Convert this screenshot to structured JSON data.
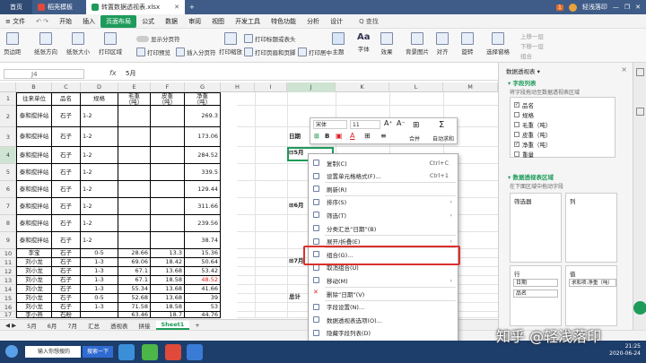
{
  "tabs": {
    "home": "首页",
    "t1": "稻壳模板",
    "t2": "转置数据透视表.xlsx",
    "badge": "1",
    "user": "轻浅落印"
  },
  "menu": {
    "file": "≡ 文件",
    "items": [
      "开始",
      "插入",
      "页面布局",
      "公式",
      "数据",
      "审阅",
      "视图",
      "开发工具",
      "特色功能",
      "分析",
      "设计"
    ],
    "active": "页面布局",
    "search": "Q 查找"
  },
  "toolbar": {
    "page_margin": "页边距",
    "orientation": "纸张方向",
    "size": "纸张大小",
    "print_area": "打印区域",
    "show_break": "显示分页符",
    "print_preview": "打印预览",
    "insert_break": "插入分页符",
    "print_scale": "打印缩放",
    "print_titles": "打印标题或表头",
    "print_header": "打印页眉和页脚",
    "print_center": "打印居中",
    "theme": "主题",
    "font": "字体",
    "effect": "效果",
    "bg": "背景图片",
    "align": "对齐",
    "rotate": "旋转",
    "select_pane": "选择窗格",
    "up": "上移一层",
    "down": "下移一层",
    "group": "组合"
  },
  "formula": {
    "namebox": "J4",
    "fx": "fx",
    "value": "5月"
  },
  "columns": [
    "B",
    "C",
    "D",
    "E",
    "F",
    "G",
    "H",
    "I",
    "J",
    "K",
    "L",
    "M"
  ],
  "rows": [
    "1",
    "2",
    "3",
    "4",
    "5",
    "6",
    "7",
    "8",
    "9",
    "10",
    "11",
    "12",
    "13",
    "14",
    "15",
    "16",
    "17"
  ],
  "table": {
    "h1": "往来单位",
    "h2": "品名",
    "h3": "规格",
    "h4": "毛重\n（吨）",
    "h5": "皮重\n（吨）",
    "h6": "净重\n（吨）",
    "top": [
      {
        "u": "泰和搅拌站",
        "p": "石子",
        "s": "1-2",
        "g": "",
        "t": "",
        "n": "269.3"
      },
      {
        "u": "泰和搅拌站",
        "p": "石子",
        "s": "1-2",
        "g": "",
        "t": "",
        "n": "173.06"
      },
      {
        "u": "泰和搅拌站",
        "p": "石子",
        "s": "1-2",
        "g": "",
        "t": "",
        "n": "284.52"
      },
      {
        "u": "泰和搅拌站",
        "p": "石子",
        "s": "1-2",
        "g": "",
        "t": "",
        "n": "339.5"
      },
      {
        "u": "泰和搅拌站",
        "p": "石子",
        "s": "1-2",
        "g": "",
        "t": "",
        "n": "129.44"
      },
      {
        "u": "泰和搅拌站",
        "p": "石子",
        "s": "1-2",
        "g": "",
        "t": "",
        "n": "311.66"
      },
      {
        "u": "泰和搅拌站",
        "p": "石子",
        "s": "1-2",
        "g": "",
        "t": "",
        "n": "239.56"
      },
      {
        "u": "泰和搅拌站",
        "p": "石子",
        "s": "1-2",
        "g": "",
        "t": "",
        "n": "38.74"
      }
    ],
    "bottom": [
      {
        "u": "李宝",
        "p": "石子",
        "s": "0-5",
        "g": "28.66",
        "t": "13.3",
        "n": "15.36"
      },
      {
        "u": "刘小龙",
        "p": "石子",
        "s": "1-3",
        "g": "69.06",
        "t": "18.42",
        "n": "50.64"
      },
      {
        "u": "刘小龙",
        "p": "石子",
        "s": "1-3",
        "g": "67.1",
        "t": "13.68",
        "n": "53.42"
      },
      {
        "u": "刘小龙",
        "p": "石子",
        "s": "1-3",
        "g": "67.1",
        "t": "18.58",
        "n": "48.52"
      },
      {
        "u": "刘小龙",
        "p": "石子",
        "s": "1-3",
        "g": "55.34",
        "t": "13.68",
        "n": "41.66"
      },
      {
        "u": "刘小龙",
        "p": "石子",
        "s": "0-5",
        "g": "52.68",
        "t": "13.68",
        "n": "39"
      },
      {
        "u": "刘小龙",
        "p": "石子",
        "s": "1-3",
        "g": "71.58",
        "t": "18.58",
        "n": "53"
      },
      {
        "u": "李小燕",
        "p": "石粉",
        "s": "",
        "g": "63.46",
        "t": "18.7",
        "n": "44.76"
      }
    ],
    "pivot_date": "日期",
    "pivot_may": "⊟5月",
    "pivot_jun": "⊞6月",
    "pivot_jul": "⊞7月",
    "pivot_total": "总计"
  },
  "minitb": {
    "font": "宋体",
    "size": "11",
    "merge": "合并",
    "autosum": "自动求和"
  },
  "context_menu": [
    {
      "label": "复制(C)",
      "shortcut": "Ctrl+C"
    },
    {
      "label": "设置单元格格式(F)...",
      "shortcut": "Ctrl+1"
    },
    {
      "label": "刷新(R)",
      "shortcut": ""
    },
    {
      "label": "排序(S)",
      "shortcut": "",
      "sub": true
    },
    {
      "label": "筛选(T)",
      "shortcut": "",
      "sub": true
    },
    {
      "label": "分类汇总“日期”(B)",
      "shortcut": ""
    },
    {
      "label": "展开/折叠(E)",
      "shortcut": "",
      "sub": true
    },
    {
      "label": "组合(G)...",
      "shortcut": ""
    },
    {
      "label": "取消组合(U)",
      "shortcut": ""
    },
    {
      "label": "移动(M)",
      "shortcut": "",
      "sub": true
    },
    {
      "label": "删除“日期”(V)",
      "shortcut": ""
    },
    {
      "label": "字段设置(N)...",
      "shortcut": ""
    },
    {
      "label": "数据透视表选项(O)...",
      "shortcut": ""
    },
    {
      "label": "隐藏字段列表(D)",
      "shortcut": ""
    }
  ],
  "panel": {
    "title": "数据透视表 ▾",
    "field_list": "▾ 字段列表",
    "hint": "将字段拖动至数据透视表区域",
    "fields": [
      {
        "name": "品名",
        "checked": true
      },
      {
        "name": "规格",
        "checked": false
      },
      {
        "name": "毛重（吨）",
        "checked": false
      },
      {
        "name": "皮重（吨）",
        "checked": false
      },
      {
        "name": "净重（吨）",
        "checked": true
      },
      {
        "name": "重量",
        "checked": false
      }
    ],
    "area_title": "▾ 数据透视表区域",
    "area_hint": "在下面区域中拖动字段",
    "filter": "筛选器",
    "col": "列",
    "row": "行",
    "val": "值",
    "row_item": "日期",
    "row_item2": "品名",
    "val_item": "求和项:净重（吨）"
  },
  "sheets": [
    "汇总",
    "5月",
    "6月",
    "7月",
    "汇总",
    "透视表",
    "拼接",
    "Sheet1",
    "+"
  ],
  "active_sheet": "Sheet1",
  "taskbar": {
    "search": "输入你想搜的",
    "searchbtn": "搜索一下",
    "time": "21:25",
    "date": "2020-06-24"
  },
  "watermark": "知乎 @轻浅落印",
  "colors": {
    "accent": "#1e9b5a",
    "tabbar": "#3f5c88",
    "highlight": "#d9302c"
  }
}
